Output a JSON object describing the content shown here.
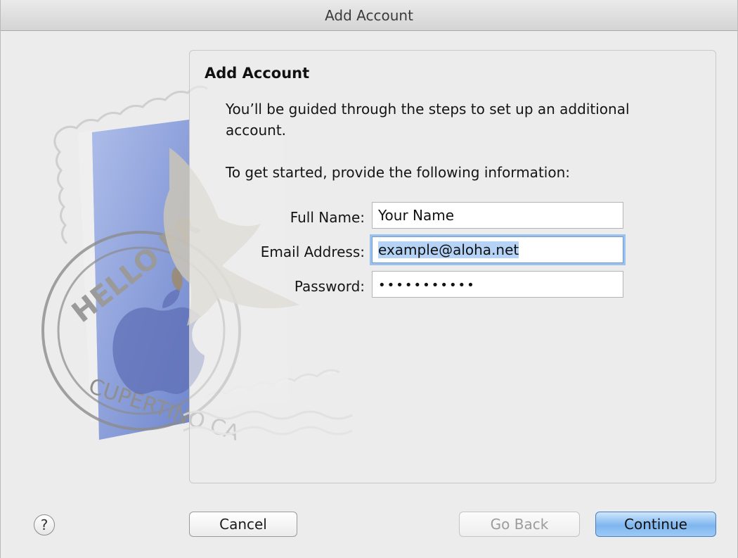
{
  "window": {
    "title": "Add Account"
  },
  "panel": {
    "heading": "Add Account",
    "intro": "You’ll be guided through the steps to set up an additional account.",
    "prompt": "To get started, provide the following information:"
  },
  "form": {
    "full_name": {
      "label": "Full Name:",
      "value": "Your Name"
    },
    "email": {
      "label": "Email Address:",
      "value": "example@aloha.net"
    },
    "password": {
      "label": "Password:",
      "value": "•••••••••••"
    }
  },
  "stamp": {
    "postmark_top": "HELLO FR",
    "postmark_bottom": "CUPERTINO CA"
  },
  "buttons": {
    "help": "?",
    "cancel": "Cancel",
    "go_back": "Go Back",
    "continue": "Continue"
  },
  "colors": {
    "focus_ring": "#9cc1ec",
    "primary_button": "#7fb6ef",
    "stamp_blue": "#8aa0dc"
  }
}
